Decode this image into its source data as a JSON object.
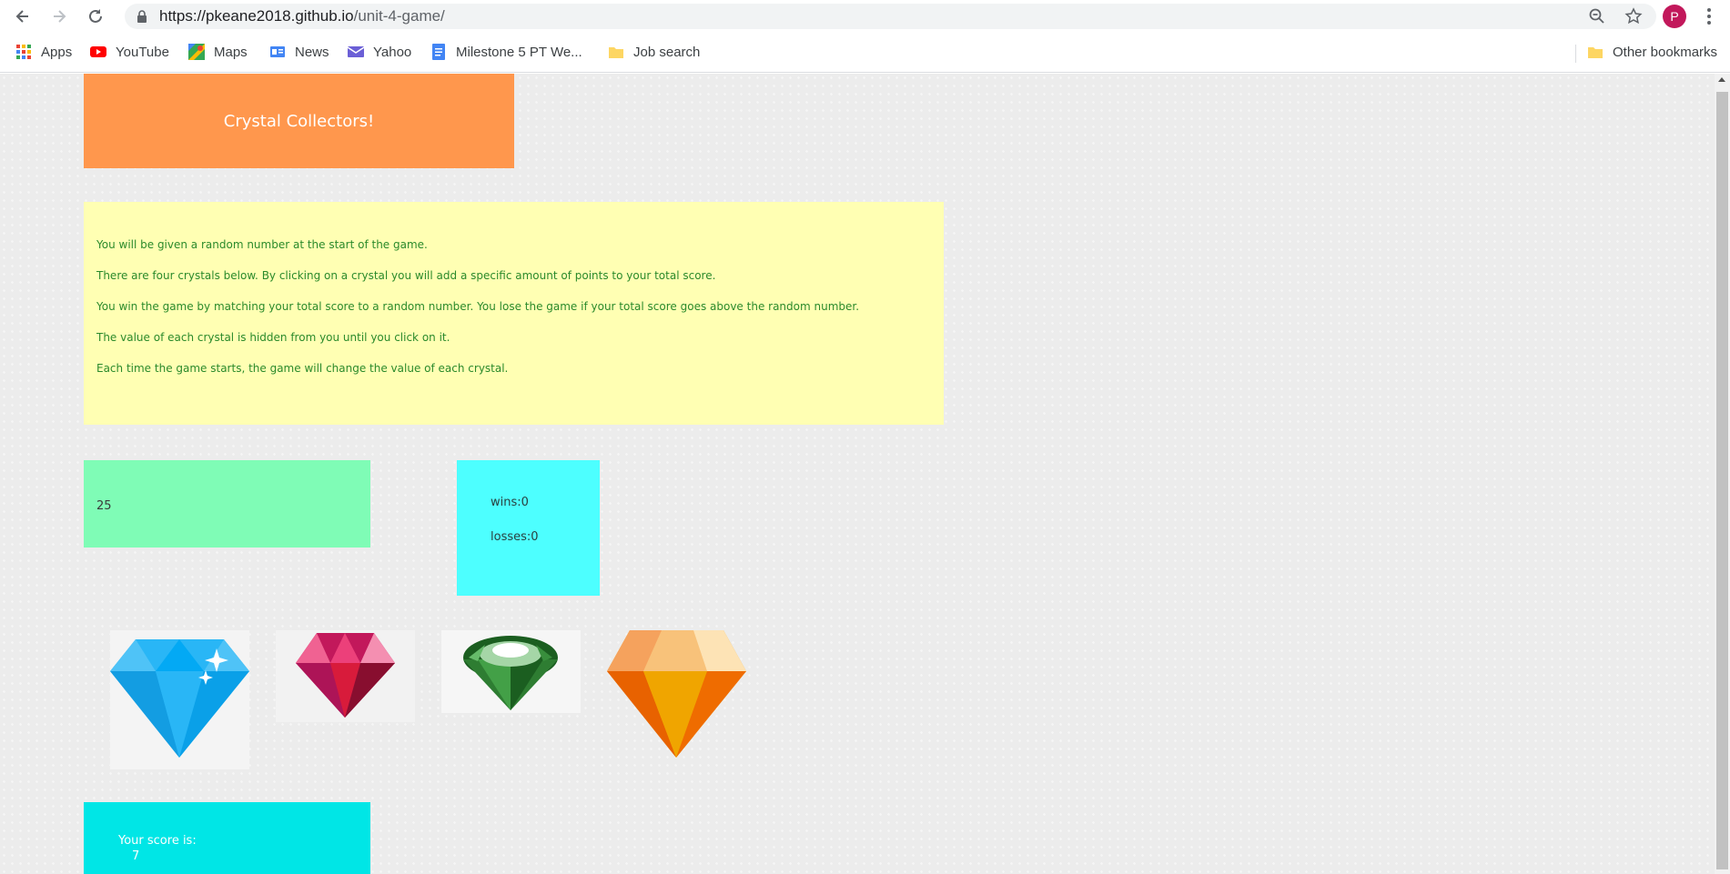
{
  "browser": {
    "url_host": "https://pkeane2018.github.io",
    "url_path": "/unit-4-game/",
    "profile_initial": "P",
    "bookmarks": [
      {
        "label": "Apps",
        "icon": "apps-grid-icon"
      },
      {
        "label": "YouTube",
        "icon": "youtube-icon"
      },
      {
        "label": "Maps",
        "icon": "maps-icon"
      },
      {
        "label": "News",
        "icon": "news-icon"
      },
      {
        "label": "Yahoo",
        "icon": "yahoo-mail-icon"
      },
      {
        "label": "Milestone 5 PT We...",
        "icon": "docs-icon"
      },
      {
        "label": "Job search",
        "icon": "folder-icon"
      }
    ],
    "other_bookmarks": "Other bookmarks"
  },
  "game": {
    "title": "Crystal Collectors!",
    "instructions": [
      "You will be given a random number at the start of the game.",
      "There are four crystals below. By clicking on a crystal you will add a specific amount of points to your total score.",
      "You win the game by matching your total score to a random number. You lose the game if your total score goes above the random number.",
      "The value of each crystal is hidden from you until you click on it.",
      "Each time the game starts, the game will change the value of each crystal."
    ],
    "target_number": "25",
    "wins": "wins:0",
    "losses": "losses:0",
    "crystals": [
      {
        "name": "blue-crystal",
        "color": "#29b6f6"
      },
      {
        "name": "red-crystal",
        "color": "#d81b3b"
      },
      {
        "name": "green-crystal",
        "color": "#2e9e2e"
      },
      {
        "name": "orange-crystal",
        "color": "#f0a500"
      }
    ],
    "score_label": "Your score is:",
    "score_value": "7"
  },
  "colors": {
    "title_bg": "#ff974d",
    "instructions_bg": "#ffffb3",
    "instructions_text": "#2b8a2b",
    "target_bg": "#7ffcb6",
    "record_bg": "#4dffff",
    "score_bg": "#00e6e6"
  }
}
